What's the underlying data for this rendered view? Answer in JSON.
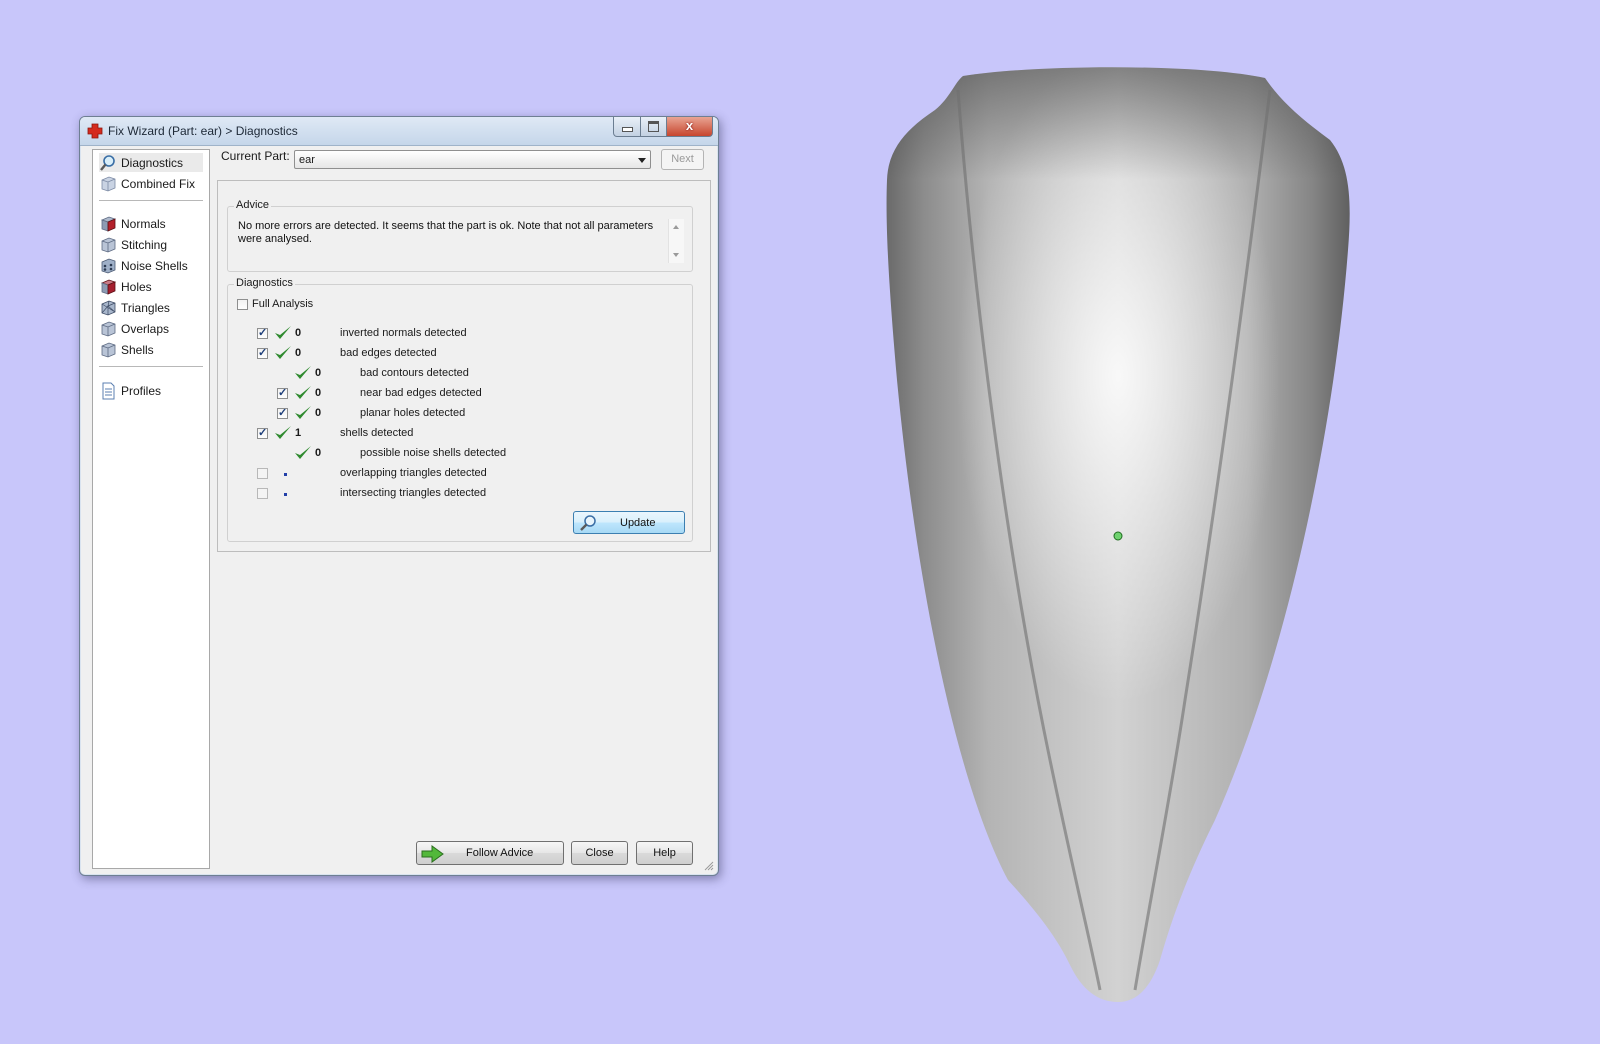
{
  "window": {
    "title": "Fix Wizard (Part: ear) > Diagnostics",
    "close_glyph": "x"
  },
  "nav": {
    "items": [
      {
        "label": "Diagnostics",
        "icon": "magnifier-icon"
      },
      {
        "label": "Combined Fix",
        "icon": "cube-icon"
      },
      {
        "label": "Normals",
        "icon": "cube-red-face-icon"
      },
      {
        "label": "Stitching",
        "icon": "cube-icon"
      },
      {
        "label": "Noise Shells",
        "icon": "dotted-cube-icon"
      },
      {
        "label": "Holes",
        "icon": "cube-hole-icon"
      },
      {
        "label": "Triangles",
        "icon": "wireframe-cube-icon"
      },
      {
        "label": "Overlaps",
        "icon": "cube-icon"
      },
      {
        "label": "Shells",
        "icon": "cube-icon"
      },
      {
        "label": "Profiles",
        "icon": "document-icon"
      }
    ],
    "selected": "Diagnostics"
  },
  "current_part": {
    "label": "Current Part:",
    "value": "ear",
    "next_label": "Next"
  },
  "advice": {
    "title": "Advice",
    "text": "No more errors are detected. It seems that the part is ok. Note that not all parameters were analysed."
  },
  "diagnostics": {
    "title": "Diagnostics",
    "full_analysis_label": "Full Analysis",
    "rows": [
      {
        "count": "0",
        "label": "inverted normals detected"
      },
      {
        "count": "0",
        "label": "bad edges detected"
      },
      {
        "count": "0",
        "label": "bad contours detected"
      },
      {
        "count": "0",
        "label": "near bad edges detected"
      },
      {
        "count": "0",
        "label": "planar holes detected"
      },
      {
        "count": "1",
        "label": "shells detected"
      },
      {
        "count": "0",
        "label": "possible noise shells detected"
      },
      {
        "count": "",
        "label": "overlapping triangles detected"
      },
      {
        "count": "",
        "label": "intersecting triangles detected"
      }
    ],
    "update_label": "Update"
  },
  "footer": {
    "follow_advice_label": "Follow Advice",
    "close_label": "Close",
    "help_label": "Help"
  },
  "colors": {
    "background": "#c8c6fa",
    "check_green": "#2f8a2f",
    "model_gray": "#9a9a9a"
  }
}
